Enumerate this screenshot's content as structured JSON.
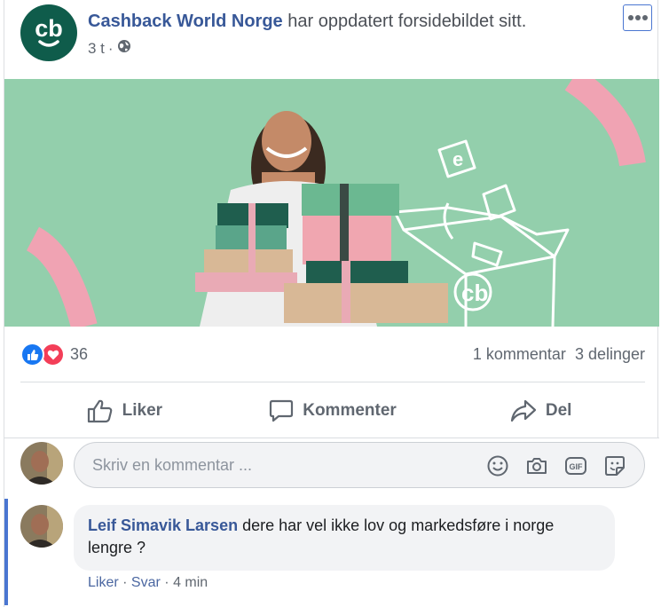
{
  "post": {
    "page_name": "Cashback World Norge",
    "action_text": "har oppdatert forsidebildet sitt.",
    "time": "3 t",
    "separator": "·",
    "privacy_icon": "globe-icon",
    "more_icon": "more-dots-icon",
    "logo_text": "cb"
  },
  "stats": {
    "reaction_icons": [
      "like-icon",
      "love-icon"
    ],
    "reaction_count": "36",
    "comments": "1 kommentar",
    "shares": "3 delinger"
  },
  "actions": [
    {
      "label": "Liker",
      "icon": "thumbs-up-icon"
    },
    {
      "label": "Kommenter",
      "icon": "comment-icon"
    },
    {
      "label": "Del",
      "icon": "share-icon"
    }
  ],
  "comment_input": {
    "placeholder": "Skriv en kommentar ...",
    "icons": [
      "emoji-icon",
      "camera-icon",
      "gif-icon",
      "sticker-icon"
    ],
    "gif_label": "GIF"
  },
  "comment": {
    "author": "Leif Simavik Larsen",
    "text": "dere har vel ikke lov og markedsføre i norge lengre ?",
    "like": "Liker",
    "reply": "Svar",
    "time": "4 min",
    "dot": "·"
  },
  "colors": {
    "brand_green": "#0f5c4b",
    "cover_bg": "#93cfac",
    "link_blue": "#385898",
    "accent_pink": "#f0a3b3"
  }
}
